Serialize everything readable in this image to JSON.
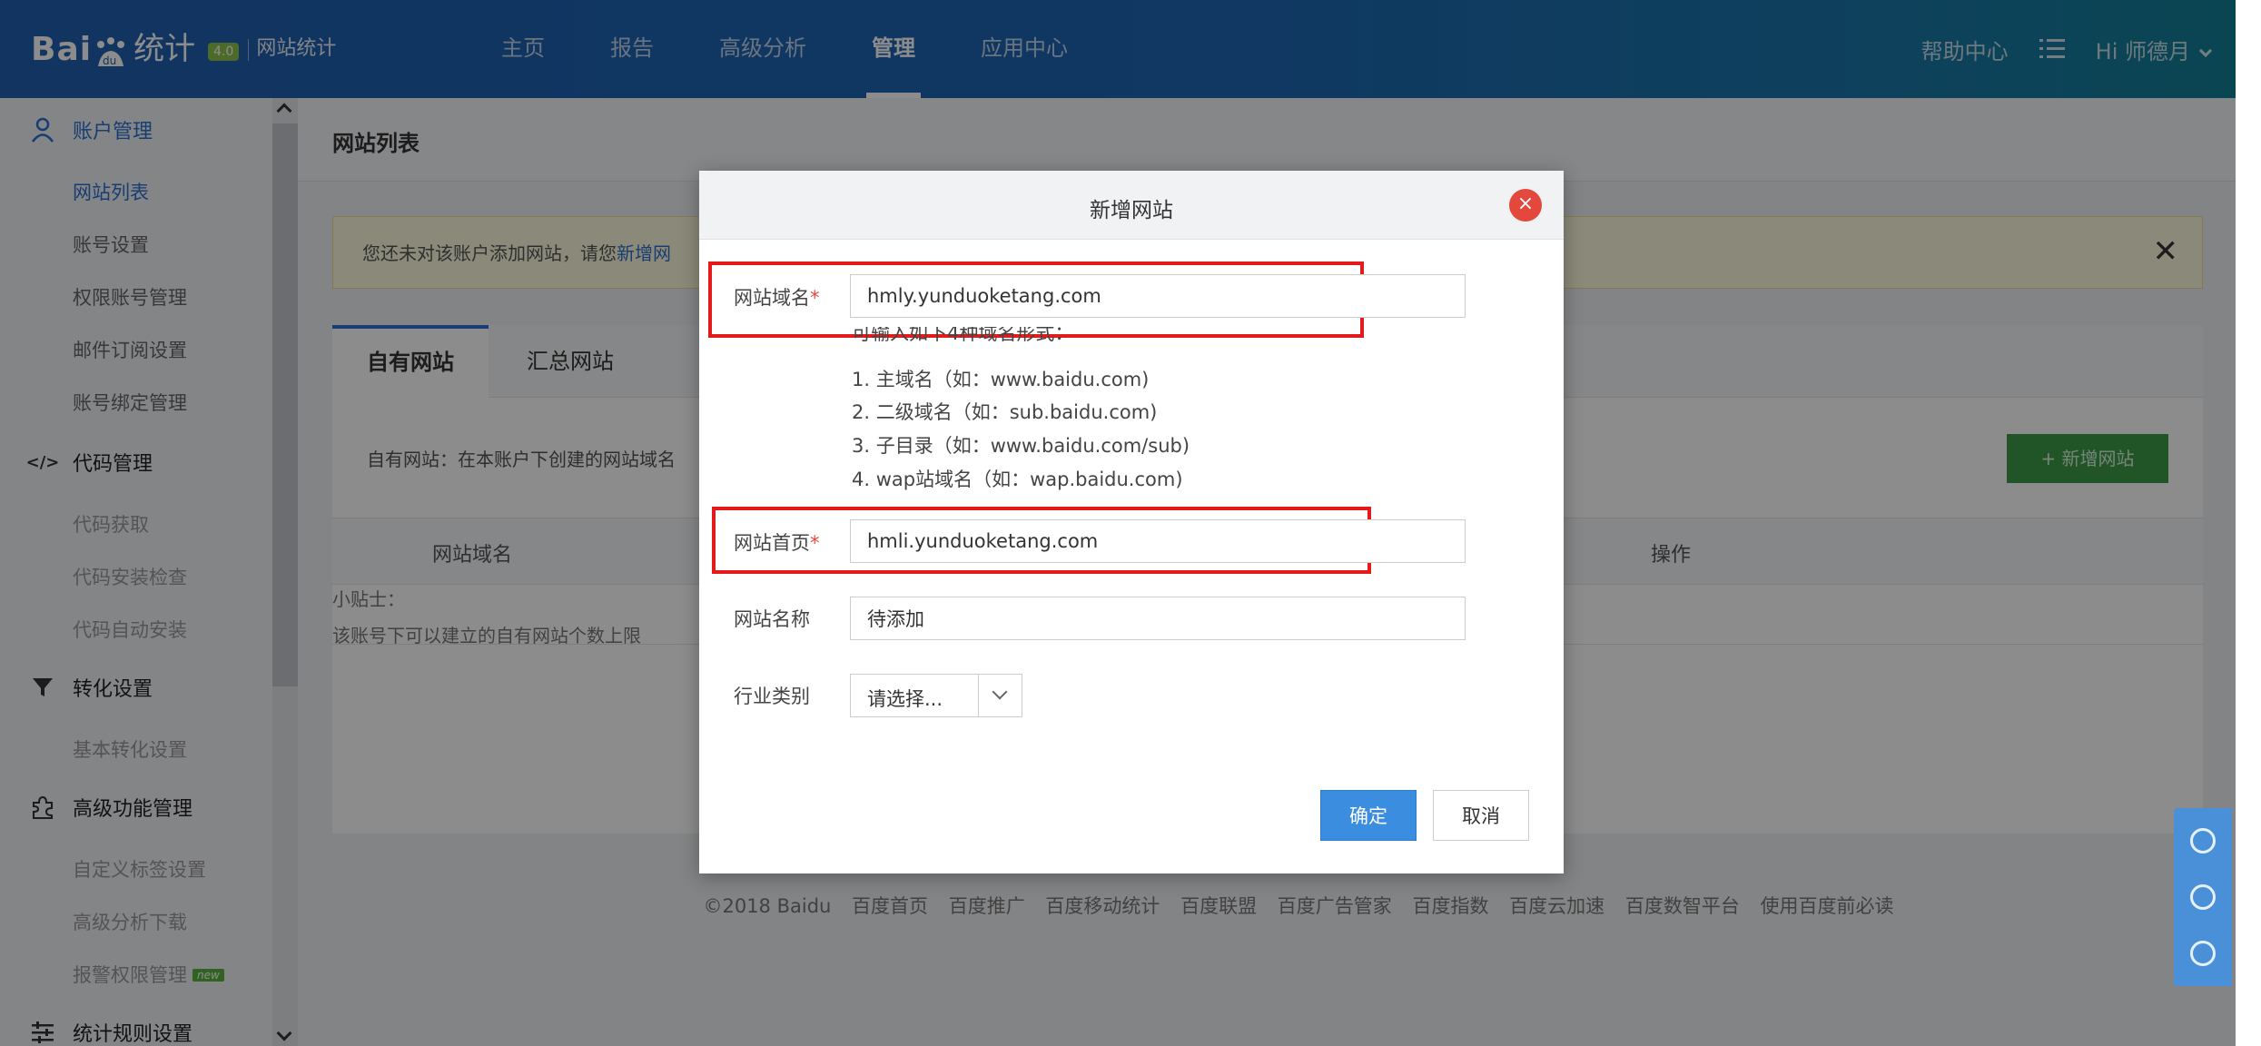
{
  "header": {
    "logo_text": "Bai",
    "logo_du": "du",
    "logo_cn": "统计",
    "logo_badge": "4.0",
    "logo_sub": "网站统计",
    "nav": [
      "主页",
      "报告",
      "高级分析",
      "管理",
      "应用中心"
    ],
    "nav_active": "管理",
    "help": "帮助中心",
    "user": "Hi  师德月"
  },
  "sidebar": {
    "groups": {
      "account": "账户管理",
      "code": "代码管理",
      "conversion": "转化设置",
      "advanced": "高级功能管理",
      "rules": "统计规则设置"
    },
    "account_items": [
      "网站列表",
      "账号设置",
      "权限账号管理",
      "邮件订阅设置",
      "账号绑定管理"
    ],
    "code_items": [
      "代码获取",
      "代码安装检查",
      "代码自动安装"
    ],
    "conversion_items": [
      "基本转化设置"
    ],
    "advanced_items": [
      "自定义标签设置",
      "高级分析下载",
      "报警权限管理"
    ],
    "new_tag": "new"
  },
  "main": {
    "page_title": "网站列表",
    "notice_text": "您还未对该账户添加网站，请您",
    "notice_link": "新增网",
    "tabs": [
      "自有网站",
      "汇总网站"
    ],
    "tab_desc": "自有网站：在本账户下创建的网站域名",
    "add_site_button": "+ 新增网站",
    "columns": [
      "网站域名",
      "操作"
    ],
    "tips_title": "小贴士：",
    "tips_text": "该账号下可以建立的自有网站个数上限"
  },
  "footer": [
    "©2018 Baidu",
    "百度首页",
    "百度推广",
    "百度移动统计",
    "百度联盟",
    "百度广告管家",
    "百度指数",
    "百度云加速",
    "百度数智平台",
    "使用百度前必读"
  ],
  "modal": {
    "title": "新增网站",
    "close": "×",
    "domain_label": "网站域名",
    "domain_value": "hmly.yunduoketang.com",
    "hint_intro": "可输入如下4种域名形式：",
    "hints": [
      "1. 主域名（如：www.baidu.com)",
      "2. 二级域名（如：sub.baidu.com)",
      "3. 子目录（如：www.baidu.com/sub)",
      "4. wap站域名（如：wap.baidu.com)"
    ],
    "homepage_label": "网站首页",
    "homepage_value": "hmli.yunduoketang.com",
    "name_label": "网站名称",
    "name_value": "待添加",
    "industry_label": "行业类别",
    "industry_value": "请选择...",
    "required_mark": "*",
    "ok_button": "确定",
    "cancel_button": "取消"
  },
  "colors": {
    "topbar": "#1f5fb0",
    "primary": "#3b8de0",
    "success": "#3c9b48",
    "highlight_box": "#e51b1b",
    "close_button": "#e4473c"
  }
}
